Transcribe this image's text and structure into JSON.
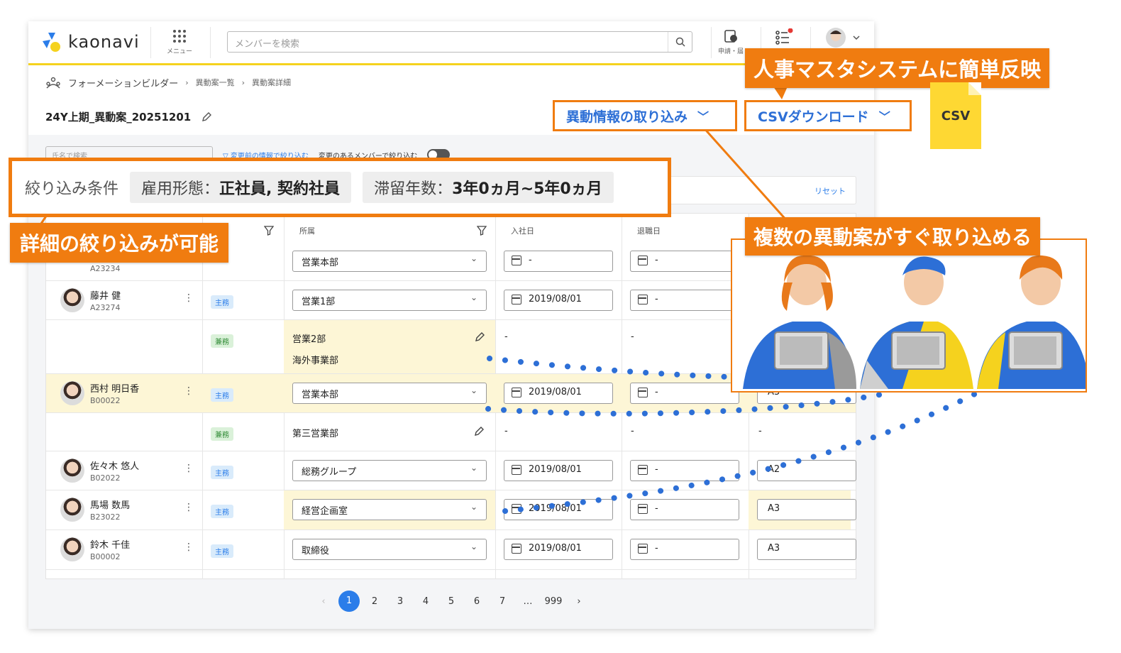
{
  "app": {
    "logo_text": "kaonavi",
    "menu_label": "メニュー",
    "search_placeholder": "メンバーを検索",
    "request_label": "申請・届"
  },
  "breadcrumb": {
    "root": "フォーメーションビルダー",
    "level2": "異動案一覧",
    "level3": "異動案詳細"
  },
  "page_title": "24Y上期_異動案_20251201",
  "toolbar": {
    "name_search_placeholder": "氏名で検索",
    "filter_link": "変更前の情報で絞り込む",
    "toggle_label": "変更のあるメンバーで絞り込む",
    "reset": "リセット"
  },
  "columns": {
    "dept": "所属",
    "join": "入社日",
    "leave": "退職日"
  },
  "rows": [
    {
      "id": "A23234",
      "badge": "主務",
      "dept": "営業本部",
      "join": "-",
      "leave": "-"
    },
    {
      "name": "藤井 健",
      "id": "A23274",
      "badge": "主務",
      "dept": "営業1部",
      "join": "2019/08/01",
      "leave": "-"
    },
    {
      "badge": "兼務",
      "dept": "営業2部",
      "dept2": "海外事業部",
      "join": "-",
      "leave": "-"
    },
    {
      "name": "西村 明日香",
      "id": "B00022",
      "badge": "主務",
      "dept": "営業本部",
      "join": "2019/08/01",
      "leave": "-",
      "grade": "A3"
    },
    {
      "badge": "兼務",
      "dept": "第三営業部",
      "join": "-",
      "leave": "-",
      "grade": "-"
    },
    {
      "name": "佐々木 悠人",
      "id": "B02022",
      "badge": "主務",
      "dept": "総務グループ",
      "join": "2019/08/01",
      "leave": "-",
      "grade": "A2"
    },
    {
      "name": "馬場 数馬",
      "id": "B23022",
      "badge": "主務",
      "dept": "経営企画室",
      "join": "2019/08/01",
      "leave": "-",
      "grade": "A3"
    },
    {
      "name": "鈴木 千佳",
      "id": "B00002",
      "badge": "主務",
      "dept": "取締役",
      "join": "2019/08/01",
      "leave": "-",
      "grade": "A3"
    }
  ],
  "pagination": {
    "pages": [
      "1",
      "2",
      "3",
      "4",
      "5",
      "6",
      "7",
      "…",
      "999"
    ],
    "current": "1"
  },
  "overlays": {
    "master_sync": "人事マスタシステムに簡単反映",
    "import_button": "異動情報の取り込み",
    "csv_button": "CSVダウンロード",
    "csv_file": "CSV",
    "filter_label": "絞り込み条件",
    "chip1_key": "雇用形態：",
    "chip1_val": "正社員, 契約社員",
    "chip2_key": "滞留年数：",
    "chip2_val": "3年0ヵ月~5年0ヵ月",
    "detail_filter": "詳細の絞り込みが可能",
    "multi_import": "複数の異動案がすぐ取り込める"
  },
  "colors": {
    "accent_orange": "#f07c10",
    "primary_blue": "#2b7de9",
    "brand_yellow": "#f5d21e",
    "highlight_row": "#fdf6d6"
  }
}
